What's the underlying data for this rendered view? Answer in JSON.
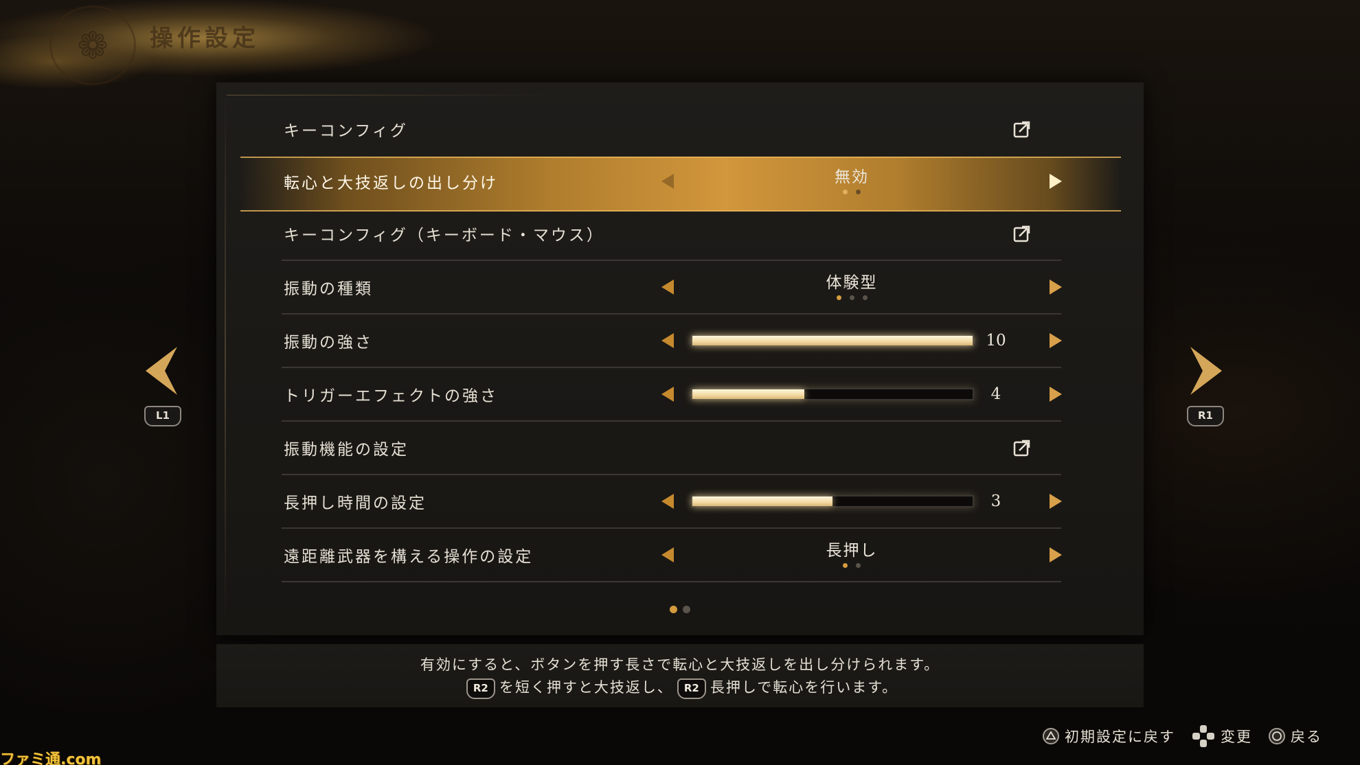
{
  "header": {
    "title": "操作設定",
    "emblem_icon": "crest-icon"
  },
  "settings": {
    "rows": [
      {
        "label": "キーコンフィグ",
        "type": "link",
        "icon": "external-link-icon"
      },
      {
        "label": "転心と大技返しの出し分け",
        "type": "option",
        "value": "無効",
        "option_count": 2,
        "option_index": 0,
        "selected": true
      },
      {
        "label": "キーコンフィグ（キーボード・マウス）",
        "type": "link",
        "icon": "external-link-icon"
      },
      {
        "label": "振動の種類",
        "type": "option",
        "value": "体験型",
        "option_count": 3,
        "option_index": 0
      },
      {
        "label": "振動の強さ",
        "type": "slider",
        "value": "10",
        "fraction": 1.0
      },
      {
        "label": "トリガーエフェクトの強さ",
        "type": "slider",
        "value": "4",
        "fraction": 0.4
      },
      {
        "label": "振動機能の設定",
        "type": "link",
        "icon": "external-link-icon"
      },
      {
        "label": "長押し時間の設定",
        "type": "slider",
        "value": "3",
        "fraction": 0.5
      },
      {
        "label": "遠距離武器を構える操作の設定",
        "type": "option",
        "value": "長押し",
        "option_count": 2,
        "option_index": 0
      }
    ]
  },
  "pagination": {
    "pages": 2,
    "current": 0
  },
  "nav": {
    "prev_button": "L1",
    "next_button": "R1"
  },
  "description": {
    "line1": "有効にすると、ボタンを押す長さで転心と大技返しを出し分けられます。",
    "line2_button1": "R2",
    "line2_text1": "を短く押すと大技返し、",
    "line2_button2": "R2",
    "line2_text2": "長押しで転心を行います。"
  },
  "footer": {
    "reset": "初期設定に戻す",
    "change": "変更",
    "back": "戻る"
  },
  "watermark": "ファミ通.com",
  "colors": {
    "accent_gold": "#d59c3e",
    "selected_row": "#d2963c",
    "panel_bg": "#1d1b18"
  }
}
